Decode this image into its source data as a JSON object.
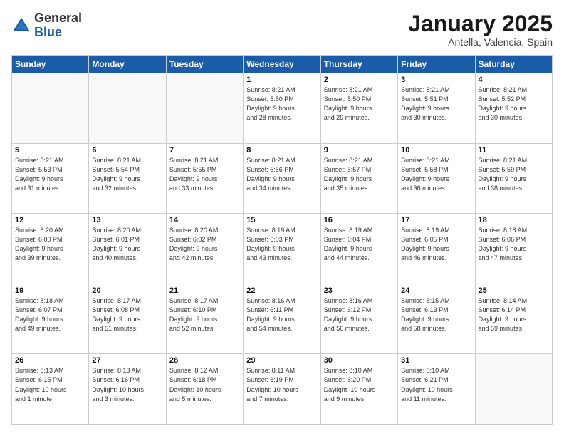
{
  "header": {
    "logo_general": "General",
    "logo_blue": "Blue",
    "month_title": "January 2025",
    "location": "Antella, Valencia, Spain"
  },
  "days_of_week": [
    "Sunday",
    "Monday",
    "Tuesday",
    "Wednesday",
    "Thursday",
    "Friday",
    "Saturday"
  ],
  "weeks": [
    [
      {
        "day": "",
        "info": ""
      },
      {
        "day": "",
        "info": ""
      },
      {
        "day": "",
        "info": ""
      },
      {
        "day": "1",
        "info": "Sunrise: 8:21 AM\nSunset: 5:50 PM\nDaylight: 9 hours\nand 28 minutes."
      },
      {
        "day": "2",
        "info": "Sunrise: 8:21 AM\nSunset: 5:50 PM\nDaylight: 9 hours\nand 29 minutes."
      },
      {
        "day": "3",
        "info": "Sunrise: 8:21 AM\nSunset: 5:51 PM\nDaylight: 9 hours\nand 30 minutes."
      },
      {
        "day": "4",
        "info": "Sunrise: 8:21 AM\nSunset: 5:52 PM\nDaylight: 9 hours\nand 30 minutes."
      }
    ],
    [
      {
        "day": "5",
        "info": "Sunrise: 8:21 AM\nSunset: 5:53 PM\nDaylight: 9 hours\nand 31 minutes."
      },
      {
        "day": "6",
        "info": "Sunrise: 8:21 AM\nSunset: 5:54 PM\nDaylight: 9 hours\nand 32 minutes."
      },
      {
        "day": "7",
        "info": "Sunrise: 8:21 AM\nSunset: 5:55 PM\nDaylight: 9 hours\nand 33 minutes."
      },
      {
        "day": "8",
        "info": "Sunrise: 8:21 AM\nSunset: 5:56 PM\nDaylight: 9 hours\nand 34 minutes."
      },
      {
        "day": "9",
        "info": "Sunrise: 8:21 AM\nSunset: 5:57 PM\nDaylight: 9 hours\nand 35 minutes."
      },
      {
        "day": "10",
        "info": "Sunrise: 8:21 AM\nSunset: 5:58 PM\nDaylight: 9 hours\nand 36 minutes."
      },
      {
        "day": "11",
        "info": "Sunrise: 8:21 AM\nSunset: 5:59 PM\nDaylight: 9 hours\nand 38 minutes."
      }
    ],
    [
      {
        "day": "12",
        "info": "Sunrise: 8:20 AM\nSunset: 6:00 PM\nDaylight: 9 hours\nand 39 minutes."
      },
      {
        "day": "13",
        "info": "Sunrise: 8:20 AM\nSunset: 6:01 PM\nDaylight: 9 hours\nand 40 minutes."
      },
      {
        "day": "14",
        "info": "Sunrise: 8:20 AM\nSunset: 6:02 PM\nDaylight: 9 hours\nand 42 minutes."
      },
      {
        "day": "15",
        "info": "Sunrise: 8:19 AM\nSunset: 6:03 PM\nDaylight: 9 hours\nand 43 minutes."
      },
      {
        "day": "16",
        "info": "Sunrise: 8:19 AM\nSunset: 6:04 PM\nDaylight: 9 hours\nand 44 minutes."
      },
      {
        "day": "17",
        "info": "Sunrise: 8:19 AM\nSunset: 6:05 PM\nDaylight: 9 hours\nand 46 minutes."
      },
      {
        "day": "18",
        "info": "Sunrise: 8:18 AM\nSunset: 6:06 PM\nDaylight: 9 hours\nand 47 minutes."
      }
    ],
    [
      {
        "day": "19",
        "info": "Sunrise: 8:18 AM\nSunset: 6:07 PM\nDaylight: 9 hours\nand 49 minutes."
      },
      {
        "day": "20",
        "info": "Sunrise: 8:17 AM\nSunset: 6:08 PM\nDaylight: 9 hours\nand 51 minutes."
      },
      {
        "day": "21",
        "info": "Sunrise: 8:17 AM\nSunset: 6:10 PM\nDaylight: 9 hours\nand 52 minutes."
      },
      {
        "day": "22",
        "info": "Sunrise: 8:16 AM\nSunset: 6:11 PM\nDaylight: 9 hours\nand 54 minutes."
      },
      {
        "day": "23",
        "info": "Sunrise: 8:16 AM\nSunset: 6:12 PM\nDaylight: 9 hours\nand 56 minutes."
      },
      {
        "day": "24",
        "info": "Sunrise: 8:15 AM\nSunset: 6:13 PM\nDaylight: 9 hours\nand 58 minutes."
      },
      {
        "day": "25",
        "info": "Sunrise: 8:14 AM\nSunset: 6:14 PM\nDaylight: 9 hours\nand 59 minutes."
      }
    ],
    [
      {
        "day": "26",
        "info": "Sunrise: 8:13 AM\nSunset: 6:15 PM\nDaylight: 10 hours\nand 1 minute."
      },
      {
        "day": "27",
        "info": "Sunrise: 8:13 AM\nSunset: 6:16 PM\nDaylight: 10 hours\nand 3 minutes."
      },
      {
        "day": "28",
        "info": "Sunrise: 8:12 AM\nSunset: 6:18 PM\nDaylight: 10 hours\nand 5 minutes."
      },
      {
        "day": "29",
        "info": "Sunrise: 8:11 AM\nSunset: 6:19 PM\nDaylight: 10 hours\nand 7 minutes."
      },
      {
        "day": "30",
        "info": "Sunrise: 8:10 AM\nSunset: 6:20 PM\nDaylight: 10 hours\nand 9 minutes."
      },
      {
        "day": "31",
        "info": "Sunrise: 8:10 AM\nSunset: 6:21 PM\nDaylight: 10 hours\nand 11 minutes."
      },
      {
        "day": "",
        "info": ""
      }
    ]
  ]
}
